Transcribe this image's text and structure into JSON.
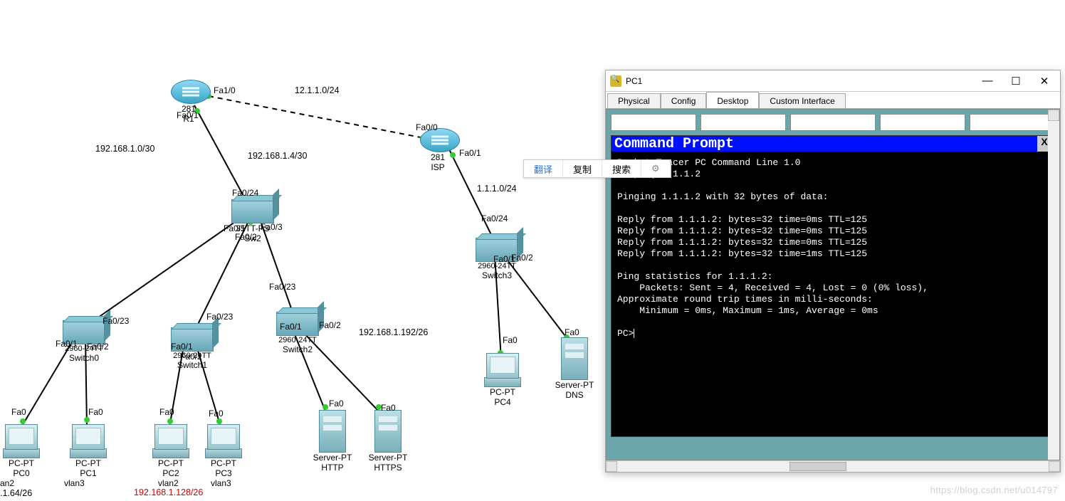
{
  "topology": {
    "subnets": {
      "r1_isp": "12.1.1.0/24",
      "r1_sw2_left": "192.168.1.0/30",
      "r1_sw2_right": "192.168.1.4/30",
      "sw2_right": "192.168.1.192/26",
      "isp_right": "1.1.1.0/24",
      "vlan2b": ".1.64/26",
      "sw1_seg": "192.168.1.128/26"
    },
    "ports": {
      "r1_fa10": "Fa1/0",
      "r1_fa01": "Fa0/1",
      "isp_fa00": "Fa0/0",
      "isp_fa01": "Fa0/1",
      "sw2_fa024": "Fa0/24",
      "sw2_fa01": "Fa0/1",
      "sw2_fa02": "Fa0/2",
      "sw2_fa03": "Fa0/3",
      "sw0_fa023": "Fa0/23",
      "sw0_fa01": "Fa0/1",
      "sw0_fa02": "Fa0/2",
      "sw1_fa023": "Fa0/23",
      "sw1_fa01": "Fa0/1",
      "sw1_fa02": "Fa0/2",
      "sw2b_fa023": "Fa0/23",
      "sw2b_fa01": "Fa0/1",
      "sw2b_fa02": "Fa0/2",
      "sw3_fa024": "Fa0/24",
      "sw3_fa01": "Fa0/1",
      "sw3_fa02": "Fa0/2",
      "pc_fa0": "Fa0"
    },
    "devices": {
      "r1_model": "281",
      "r1_name": "R1",
      "isp_model": "281",
      "isp_name": "ISP",
      "sw2_model": "35",
      "sw2_name": "Sw2",
      "sw2_full": "35TT-PS",
      "sw0_model": "2960-24TT",
      "sw0_name": "Switch0",
      "sw1_model": "2960-24TT",
      "sw1_name": "Switch1",
      "sw2b_model": "2960-24TT",
      "sw2b_name": "Switch2",
      "sw3_model": "2960-24TT",
      "sw3_name": "Switch3",
      "pc0_type": "PC-PT",
      "pc0_name": "PC0",
      "pc1_type": "PC-PT",
      "pc1_name": "PC1",
      "pc2_type": "PC-PT",
      "pc2_name": "PC2",
      "pc3_type": "PC-PT",
      "pc3_name": "PC3",
      "pc4_type": "PC-PT",
      "pc4_name": "PC4",
      "http_type": "Server-PT",
      "http_name": "HTTP",
      "https_type": "Server-PT",
      "https_name": "HTTPS",
      "dns_type": "Server-PT",
      "dns_name": "DNS"
    },
    "vlans": {
      "pc0": "an2",
      "pc1": "vlan3",
      "pc2": "vlan2",
      "pc3": "vlan3"
    }
  },
  "ctx": {
    "translate": "翻译",
    "copy": "复制",
    "search": "搜索"
  },
  "window": {
    "title": "PC1",
    "tabs": {
      "physical": "Physical",
      "config": "Config",
      "desktop": "Desktop",
      "custom": "Custom Interface"
    },
    "cmd": {
      "title": "Command Prompt",
      "close": "X",
      "output": "Packet Tracer PC Command Line 1.0\nPC>ping 1.1.1.2\n\nPinging 1.1.1.2 with 32 bytes of data:\n\nReply from 1.1.1.2: bytes=32 time=0ms TTL=125\nReply from 1.1.1.2: bytes=32 time=0ms TTL=125\nReply from 1.1.1.2: bytes=32 time=0ms TTL=125\nReply from 1.1.1.2: bytes=32 time=1ms TTL=125\n\nPing statistics for 1.1.1.2:\n    Packets: Sent = 4, Received = 4, Lost = 0 (0% loss),\nApproximate round trip times in milli-seconds:\n    Minimum = 0ms, Maximum = 1ms, Average = 0ms\n\nPC>"
    }
  },
  "watermark": "https://blog.csdn.net/u014797"
}
